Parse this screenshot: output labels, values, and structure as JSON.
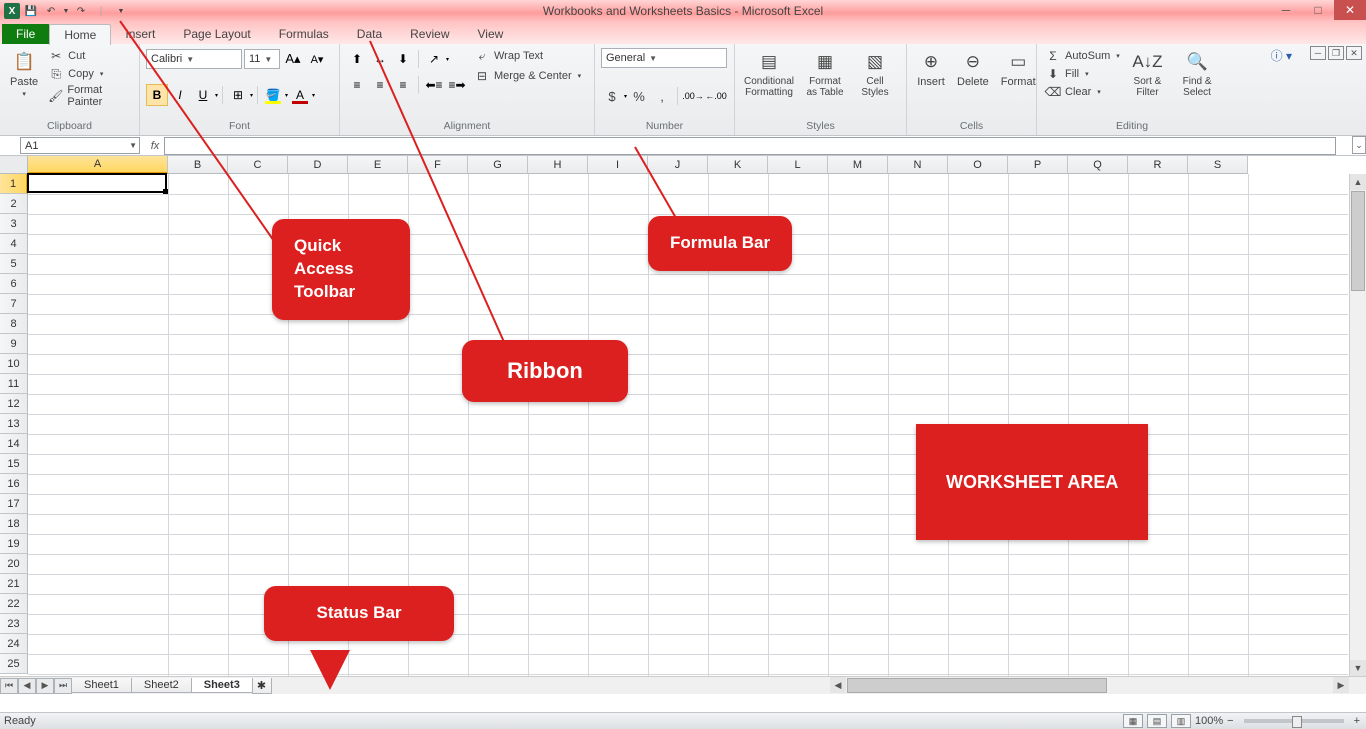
{
  "title": "Workbooks and Worksheets Basics - Microsoft Excel",
  "qat": {
    "save": "💾",
    "undo": "↶",
    "redo": "↷"
  },
  "tabs": {
    "file": "File",
    "home": "Home",
    "insert": "Insert",
    "page_layout": "Page Layout",
    "formulas": "Formulas",
    "data": "Data",
    "review": "Review",
    "view": "View"
  },
  "ribbon": {
    "clipboard": {
      "label": "Clipboard",
      "paste": "Paste",
      "cut": "Cut",
      "copy": "Copy",
      "painter": "Format Painter"
    },
    "font": {
      "label": "Font",
      "name": "Calibri",
      "size": "11"
    },
    "alignment": {
      "label": "Alignment",
      "wrap": "Wrap Text",
      "merge": "Merge & Center"
    },
    "number": {
      "label": "Number",
      "format": "General"
    },
    "styles": {
      "label": "Styles",
      "cond": "Conditional Formatting",
      "table": "Format as Table",
      "cell": "Cell Styles"
    },
    "cells": {
      "label": "Cells",
      "insert": "Insert",
      "delete": "Delete",
      "format": "Format"
    },
    "editing": {
      "label": "Editing",
      "autosum": "AutoSum",
      "fill": "Fill",
      "clear": "Clear",
      "sort": "Sort & Filter",
      "find": "Find & Select"
    }
  },
  "namebox": "A1",
  "columns": [
    "A",
    "B",
    "C",
    "D",
    "E",
    "F",
    "G",
    "H",
    "I",
    "J",
    "K",
    "L",
    "M",
    "N",
    "O",
    "P",
    "Q",
    "R",
    "S"
  ],
  "rows_count": 25,
  "sheets": {
    "s1": "Sheet1",
    "s2": "Sheet2",
    "s3": "Sheet3"
  },
  "status": {
    "ready": "Ready",
    "zoom": "100%"
  },
  "callouts": {
    "qat": "Quick Access Toolbar",
    "ribbon": "Ribbon",
    "formula": "Formula Bar",
    "status": "Status Bar",
    "area": "WORKSHEET AREA"
  }
}
